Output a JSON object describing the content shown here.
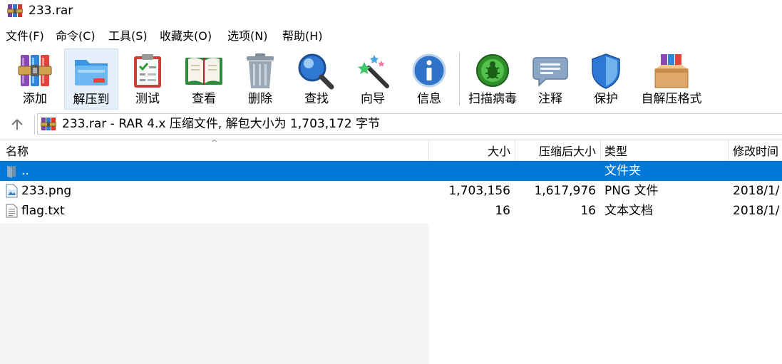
{
  "window": {
    "title": "233.rar",
    "app_icon": "winrar-icon"
  },
  "menu": [
    "文件(F)",
    "命令(C)",
    "工具(S)",
    "收藏夹(O)",
    "选项(N)",
    "帮助(H)"
  ],
  "toolbar": [
    {
      "label": "添加",
      "icon": "winrar-books-icon"
    },
    {
      "label": "解压到",
      "icon": "folder-extract-icon"
    },
    {
      "label": "测试",
      "icon": "checklist-icon"
    },
    {
      "label": "查看",
      "icon": "open-book-icon"
    },
    {
      "label": "删除",
      "icon": "trash-icon"
    },
    {
      "label": "查找",
      "icon": "magnifier-icon"
    },
    {
      "label": "向导",
      "icon": "magic-wand-icon"
    },
    {
      "label": "信息",
      "icon": "info-icon"
    },
    {
      "label": "扫描病毒",
      "icon": "virus-scan-icon"
    },
    {
      "label": "注释",
      "icon": "comment-icon"
    },
    {
      "label": "保护",
      "icon": "shield-icon"
    },
    {
      "label": "自解压格式",
      "icon": "sfx-box-icon"
    }
  ],
  "address": {
    "up_icon": "up-arrow-icon",
    "text": "233.rar - RAR 4.x 压缩文件, 解包大小为 1,703,172 字节"
  },
  "columns": {
    "name": "名称",
    "size": "大小",
    "packed": "压缩后大小",
    "type": "类型",
    "modified": "修改时间"
  },
  "sort_indicator": "^",
  "files": [
    {
      "name": "..",
      "size": "",
      "packed": "",
      "type": "文件夹",
      "modified": "",
      "icon": "parent-folder-icon",
      "selected": true
    },
    {
      "name": "233.png",
      "size": "1,703,156",
      "packed": "1,617,976",
      "type": "PNG 文件",
      "modified": "2018/1/",
      "icon": "image-file-icon",
      "selected": false
    },
    {
      "name": "flag.txt",
      "size": "16",
      "packed": "16",
      "type": "文本文档",
      "modified": "2018/1/",
      "icon": "text-file-icon",
      "selected": false
    }
  ],
  "colors": {
    "selection": "#0078d7",
    "toolbar_active": "#e5f0fb"
  }
}
